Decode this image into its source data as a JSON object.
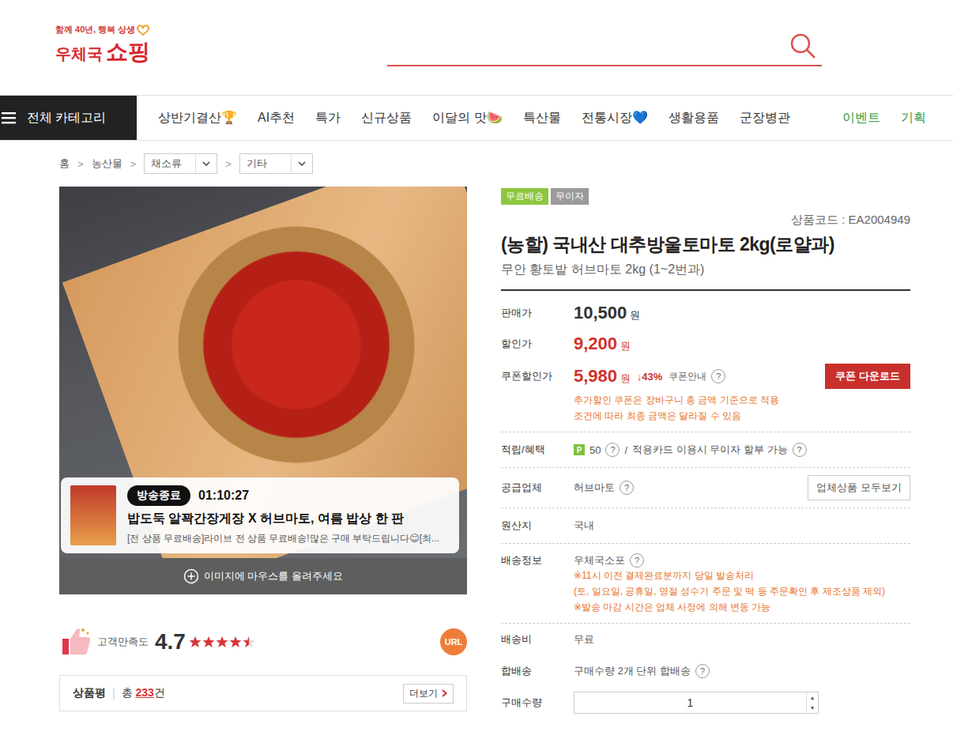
{
  "header": {
    "logo": {
      "tagline": "함께 40년, 행복 상생",
      "name": "우체국",
      "name2": "쇼핑"
    }
  },
  "nav": {
    "all_categories": "전체 카테고리",
    "items": [
      {
        "label": "상반기결산🏆",
        "color": "#333333"
      },
      {
        "label": "AI추천",
        "color": "#333333"
      },
      {
        "label": "특가",
        "color": "#333333"
      },
      {
        "label": "신규상품",
        "color": "#333333"
      },
      {
        "label": "이달의 맛🍉",
        "color": "#333333"
      },
      {
        "label": "특산물",
        "color": "#333333"
      },
      {
        "label": "전통시장💙",
        "color": "#333333"
      },
      {
        "label": "생활용품",
        "color": "#333333"
      },
      {
        "label": "군장병관",
        "color": "#333333"
      },
      {
        "label": "이벤트",
        "color": "#2e9a3c"
      },
      {
        "label": "기획",
        "color": "#2e9a3c"
      }
    ]
  },
  "breadcrumb": {
    "home": "홈",
    "category": "농산물",
    "separator": ">",
    "selects": [
      "채소류",
      "기타"
    ]
  },
  "product_image": {
    "live": {
      "badge": "방송종료",
      "time": "01:10:27",
      "title": "밥도둑 알꽉간장게장 X 허브마토, 여름 밥상 한 판",
      "desc": "[전 상품 무료배송]라이브 전 상품 무료배송!많은 구매 부탁드립니다😊[최..."
    },
    "hover_hint": "이미지에 마우스를 올려주세요"
  },
  "rating": {
    "label": "고객만족도",
    "score": "4.7",
    "stars": 4.5,
    "url_badge": "URL"
  },
  "reviews": {
    "label": "상품평",
    "divider": "|",
    "total_prefix": "총",
    "count": "233",
    "suffix": "건",
    "more": "더보기"
  },
  "product": {
    "badges": [
      {
        "label": "무료배송",
        "color": "#8dc63f"
      },
      {
        "label": "무이자",
        "color": "#9a9a9a"
      }
    ],
    "code": "상품코드 : EA2004949",
    "title": "(농할) 국내산 대추방울토마토 2kg(로얄과)",
    "subtitle": "무안 황토밭 허브마토 2kg (1~2번과)"
  },
  "price": {
    "label": "판매가",
    "value": "10,500",
    "unit": "원"
  },
  "discount": {
    "label": "할인가",
    "value": "9,200",
    "unit": "원"
  },
  "coupon": {
    "label": "쿠폰할인가",
    "value": "5,980",
    "unit": "원",
    "rate": "↓43%",
    "guide": "쿠폰안내",
    "help": "?",
    "button": "쿠폰 다운로드",
    "notes": [
      "추가할인 쿠폰은 장바구니 총 금액 기준으로 적용",
      "조건에 따라 최종 금액은 달라질 수 있음"
    ]
  },
  "benefit": {
    "label": "적립/혜택",
    "point_badge": "P",
    "points": "50",
    "help": "?",
    "divider": "/",
    "card": "적용카드 이용시 무이자 할부 가능",
    "card_help": "?"
  },
  "supplier": {
    "label": "공급업체",
    "value": "허브마토",
    "help": "?",
    "button": "업체상품 모두보기"
  },
  "origin": {
    "label": "원산지",
    "value": "국내"
  },
  "delivery": {
    "label": "배송정보",
    "value": "우체국소포",
    "help": "?",
    "notes": [
      "※11시 이전 결제완료분까지 당일 발송처리",
      "(토, 일요일, 공휴일, 명절 성수기 주문 및 떡 등 주문확인 후 제조상품 제외)",
      "※발송 마감 시간은 업체 사정에 의해 변동 가능"
    ]
  },
  "shipping_fee": {
    "label": "배송비",
    "value": "무료"
  },
  "combined": {
    "label": "합배송",
    "value": "구매수량 2개 단위 합배송",
    "help": "?"
  },
  "quantity": {
    "label": "구매수량",
    "value": "1",
    "spinner": [
      "▲",
      "▼"
    ]
  }
}
